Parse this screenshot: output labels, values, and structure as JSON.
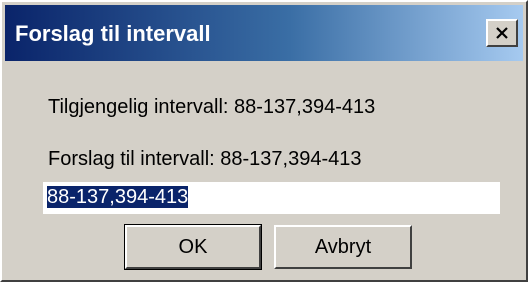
{
  "window": {
    "title": "Forslag til intervall",
    "close_icon": "close-x-icon"
  },
  "dialog": {
    "available_label": "Tilgjengelig intervall: 88-137,394-413",
    "suggest_label": "Forslag til intervall: 88-137,394-413",
    "input_value": "88-137,394-413",
    "input_selected": true
  },
  "buttons": {
    "ok_label": "OK",
    "cancel_label": "Avbryt"
  },
  "colors": {
    "titlebar_start": "#0a246a",
    "titlebar_end": "#a6caf0",
    "selection": "#0a246a",
    "face": "#d4d0c8"
  }
}
